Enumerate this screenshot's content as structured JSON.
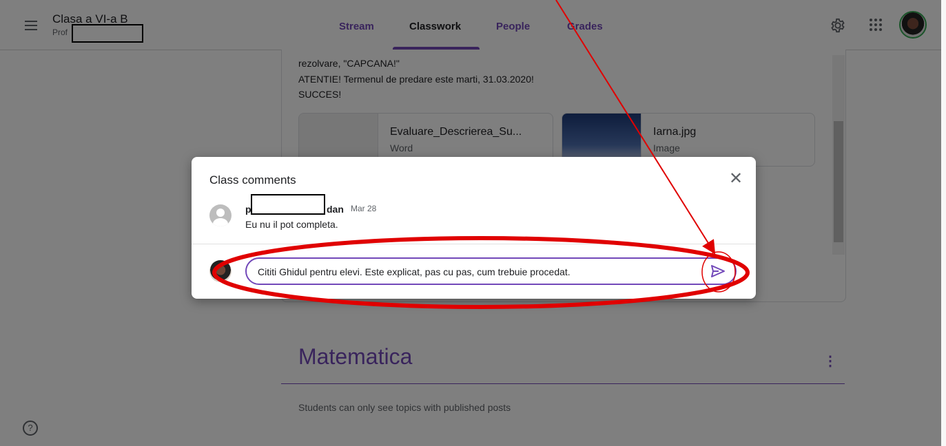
{
  "header": {
    "class_name": "Clasa a VI-a B",
    "teacher_prefix": "Prof",
    "tabs": [
      {
        "label": "Stream",
        "active": false
      },
      {
        "label": "Classwork",
        "active": true
      },
      {
        "label": "People",
        "active": false
      },
      {
        "label": "Grades",
        "active": false
      }
    ],
    "icons": [
      "hamburger-menu-icon",
      "gear-icon",
      "apps-grid-icon",
      "avatar"
    ]
  },
  "assignment": {
    "text_line1": "rezolvare, \"CAPCANA!\"",
    "text_line2": "ATENTIE! Termenul de predare este marti, 31.03.2020!",
    "text_line3": "SUCCES!",
    "attachments": [
      {
        "name": "Evaluare_Descrierea_Su...",
        "type": "Word"
      },
      {
        "name": "Iarna.jpg",
        "type": "Image"
      }
    ]
  },
  "topic": {
    "title": "Matematica",
    "note": "Students can only see topics with published posts"
  },
  "dialog": {
    "title": "Class comments",
    "comment": {
      "author_start": "p",
      "author_end": "dan",
      "date": "Mar 28",
      "text": "Eu nu il pot completa."
    },
    "input_value": "Cititi Ghidul pentru elevi. Este explicat, pas cu pas, cum trebuie procedat."
  },
  "colors": {
    "accent": "#7248b9",
    "annotation": "#e00000"
  }
}
